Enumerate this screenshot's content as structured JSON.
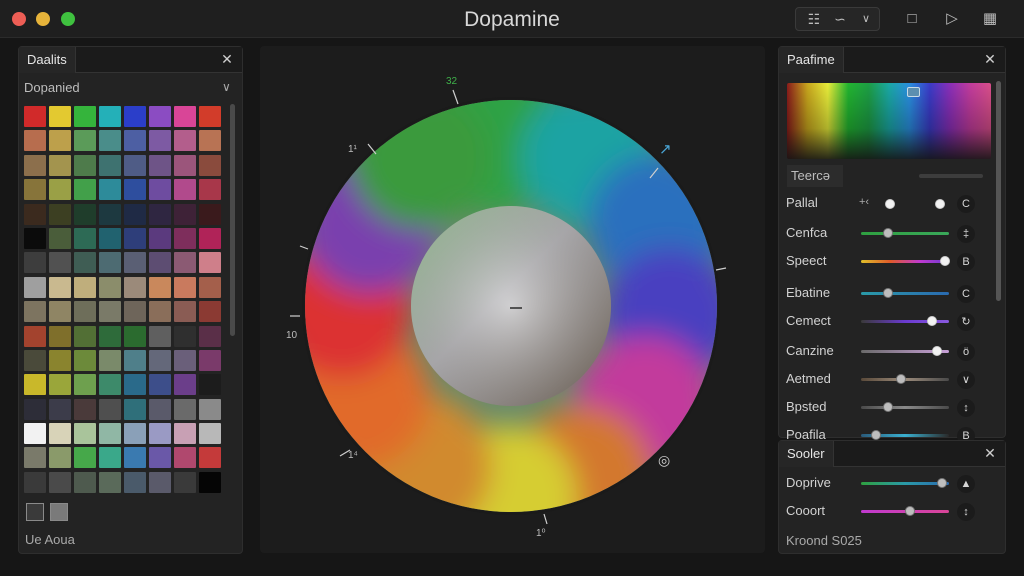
{
  "app": {
    "title": "Dopamine"
  },
  "toolbar": {
    "icons": [
      "calendar-icon",
      "waveform-icon",
      "chevron-down-icon",
      "square-icon",
      "tag-icon",
      "grid-icon"
    ]
  },
  "left_panel": {
    "tab": "Daalits",
    "dropdown_value": "Dopanied",
    "footer": "Ue Aoua",
    "swatch_colors": [
      "#d12a2a",
      "#e3c930",
      "#35b43c",
      "#24b0b8",
      "#2b3ec9",
      "#8b4cc2",
      "#d94597",
      "#d23c2a",
      "#b76d4e",
      "#bda04b",
      "#5b9b59",
      "#4a8d8a",
      "#4d5fa3",
      "#7d5aa3",
      "#b35e8c",
      "#b87354",
      "#8c6f4c",
      "#a3944e",
      "#4e7b4b",
      "#3e7270",
      "#4f5c86",
      "#6e5487",
      "#9b557b",
      "#8a4b3d",
      "#87743a",
      "#9aa046",
      "#42a04a",
      "#2d8b9a",
      "#2e4e9e",
      "#6e4ca0",
      "#b14a8c",
      "#a8374a",
      "#3b2a1e",
      "#3c3f22",
      "#1f3d2b",
      "#1d3940",
      "#1f2a45",
      "#2f2641",
      "#3e2237",
      "#3a1a1c",
      "#0b0b0b",
      "#4a5d3a",
      "#2d6a55",
      "#21626f",
      "#2e3e7a",
      "#5b3a7e",
      "#7e2e5c",
      "#b02358",
      "#3d3d3d",
      "#515151",
      "#3f5d54",
      "#4d6b72",
      "#5a5f74",
      "#5d4d72",
      "#8b5a73",
      "#cf7f8a",
      "#9f9f9f",
      "#c9b98f",
      "#bfae7c",
      "#8b8d6b",
      "#9b8a7a",
      "#c9885c",
      "#c97a5e",
      "#a45f4b",
      "#7d7460",
      "#8f8564",
      "#6e6e5a",
      "#7a7a68",
      "#6e655a",
      "#8a6e5a",
      "#8a5c54",
      "#8b3a33",
      "#a3432e",
      "#7f6f2b",
      "#526f35",
      "#2e6b3a",
      "#2b6b2f",
      "#5f5f5f",
      "#2f2f2f",
      "#5a2f48",
      "#4a4a3a",
      "#8a842e",
      "#6c8a3a",
      "#7a8a6a",
      "#4f7f8a",
      "#64687a",
      "#6a5f7a",
      "#7a3a6a",
      "#c9b82a",
      "#9aa63a",
      "#6ea04e",
      "#3d8a6a",
      "#2a6a8a",
      "#3d4e8a",
      "#6b3e8a",
      "#1c1c1c",
      "#2d2d38",
      "#3c3c4a",
      "#4a3a3a",
      "#4f4f4f",
      "#2f6f7a",
      "#5a5a6a",
      "#6a6a6a",
      "#8a8a8a",
      "#f2f2f2",
      "#d8d3b8",
      "#a9c49b",
      "#90b7a5",
      "#8aa0b8",
      "#9a9ac4",
      "#c8a0b4",
      "#b8b8b8",
      "#7a7a6a",
      "#8a9a6a",
      "#46a84a",
      "#3aa88a",
      "#3a7ab0",
      "#6a58a8",
      "#b0486e",
      "#c43a3a",
      "#3a3a3a",
      "#4a4a4a",
      "#4e5a4e",
      "#5a6a5a",
      "#4a5a6a",
      "#5a5a6a",
      "#3a3a3a",
      "#050505"
    ]
  },
  "canvas": {
    "tick_labels": [
      "32",
      "1¹",
      "10",
      "1⁴",
      "1⁰"
    ],
    "corner_icons": [
      "expand-arrow-icon",
      "camera-icon"
    ]
  },
  "right_panel": {
    "tab": "Paafime",
    "search_placeholder": "Teercə",
    "rows": [
      {
        "label": "Pallal",
        "type": "toggle"
      },
      {
        "label": "Cenfca",
        "type": "slider",
        "value": 0.32
      },
      {
        "label": "Speect",
        "type": "slider",
        "value": 1.0
      },
      {
        "label": "Ebatine",
        "type": "slider",
        "value": 0.32
      },
      {
        "label": "Cemect",
        "type": "slider",
        "value": 0.85
      },
      {
        "label": "Canzine",
        "type": "slider",
        "value": 0.9
      },
      {
        "label": "Aetmed",
        "type": "slider",
        "value": 0.48
      },
      {
        "label": "Bpsted",
        "type": "slider",
        "value": 0.32
      },
      {
        "label": "Poafila",
        "type": "slider",
        "value": 0.18
      }
    ]
  },
  "scale_panel": {
    "tab": "Sooler",
    "rows": [
      {
        "label": "Doprive",
        "value": 0.96
      },
      {
        "label": "Cooort",
        "value": 0.58
      }
    ],
    "footer": "Kroond S025"
  },
  "colors": {
    "window_bg": "#161616",
    "panel_bg": "#232323",
    "accent_green": "#35b43c",
    "accent_magenta": "#d94597"
  }
}
